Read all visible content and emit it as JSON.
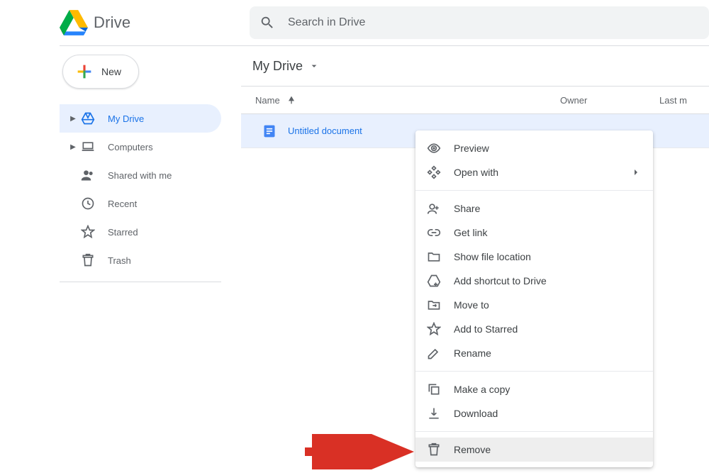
{
  "brand": "Drive",
  "search": {
    "placeholder": "Search in Drive"
  },
  "newButton": "New",
  "sidebar": {
    "myDrive": "My Drive",
    "computers": "Computers",
    "shared": "Shared with me",
    "recent": "Recent",
    "starred": "Starred",
    "trash": "Trash"
  },
  "breadcrumb": "My Drive",
  "columns": {
    "name": "Name",
    "owner": "Owner",
    "last": "Last m"
  },
  "files": [
    {
      "name": "Untitled document"
    }
  ],
  "context": {
    "preview": "Preview",
    "openWith": "Open with",
    "share": "Share",
    "getLink": "Get link",
    "showLocation": "Show file location",
    "addShortcut": "Add shortcut to Drive",
    "moveTo": "Move to",
    "addStarred": "Add to Starred",
    "rename": "Rename",
    "makeCopy": "Make a copy",
    "download": "Download",
    "remove": "Remove"
  }
}
